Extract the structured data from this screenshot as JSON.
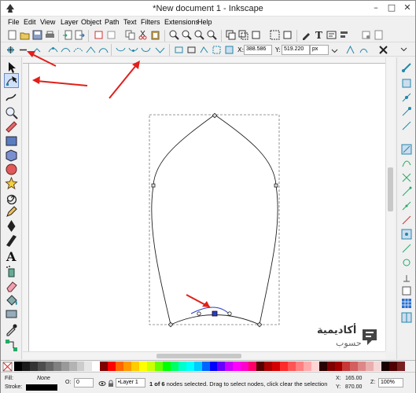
{
  "window": {
    "title": "*New document 1 - Inkscape",
    "controls": [
      "–",
      "□",
      "✕"
    ]
  },
  "menu": [
    "File",
    "Edit",
    "View",
    "Layer",
    "Object",
    "Path",
    "Text",
    "Filters",
    "Extensions",
    "Help"
  ],
  "node_toolbar": {
    "x_label": "X:",
    "x_value": "388.586",
    "y_label": "Y:",
    "y_value": "519.220",
    "unit": "px"
  },
  "status": {
    "fill_label": "Fill:",
    "fill_value": "None",
    "stroke_label": "Stroke:",
    "opacity_label": "O:",
    "opacity_value": "0",
    "layer": "•Layer 1",
    "message_bold": "1 of 6",
    "message": " nodes selected. Drag to select nodes, click clear the selection",
    "x_label": "X:",
    "x_value": "165.00",
    "y_label": "Y:",
    "y_value": "870.00",
    "zoom_label": "Z:",
    "zoom_value": "100%"
  },
  "watermark": {
    "arabic_top": "أكاديمية",
    "arabic_bottom": "حسوب"
  },
  "colors": {
    "accent_red": "#e0201a",
    "node_selected": "#2a3fbf",
    "active_tool_bg": "#cfe0f8"
  },
  "palette_colors": [
    "#000000",
    "#1a1a1a",
    "#333333",
    "#4d4d4d",
    "#666666",
    "#808080",
    "#999999",
    "#b3b3b3",
    "#cccccc",
    "#e6e6e6",
    "#ffffff",
    "#800000",
    "#ff0000",
    "#ff6600",
    "#ff9900",
    "#ffcc00",
    "#ffff00",
    "#ccff00",
    "#66ff00",
    "#00ff00",
    "#00ff66",
    "#00ffcc",
    "#00ffff",
    "#00ccff",
    "#0066ff",
    "#0000ff",
    "#6600ff",
    "#cc00ff",
    "#ff00ff",
    "#ff00cc",
    "#ff0066",
    "#550000",
    "#aa0000",
    "#d40000",
    "#ff2a2a",
    "#ff5555",
    "#ff8080",
    "#ffaaaa",
    "#ffd5d5",
    "#2b0000",
    "#800000",
    "#a00000",
    "#c83737",
    "#d35f5f",
    "#de8787",
    "#e9afaf",
    "#f4d7d7",
    "#1a0000",
    "#500000",
    "#782121"
  ]
}
